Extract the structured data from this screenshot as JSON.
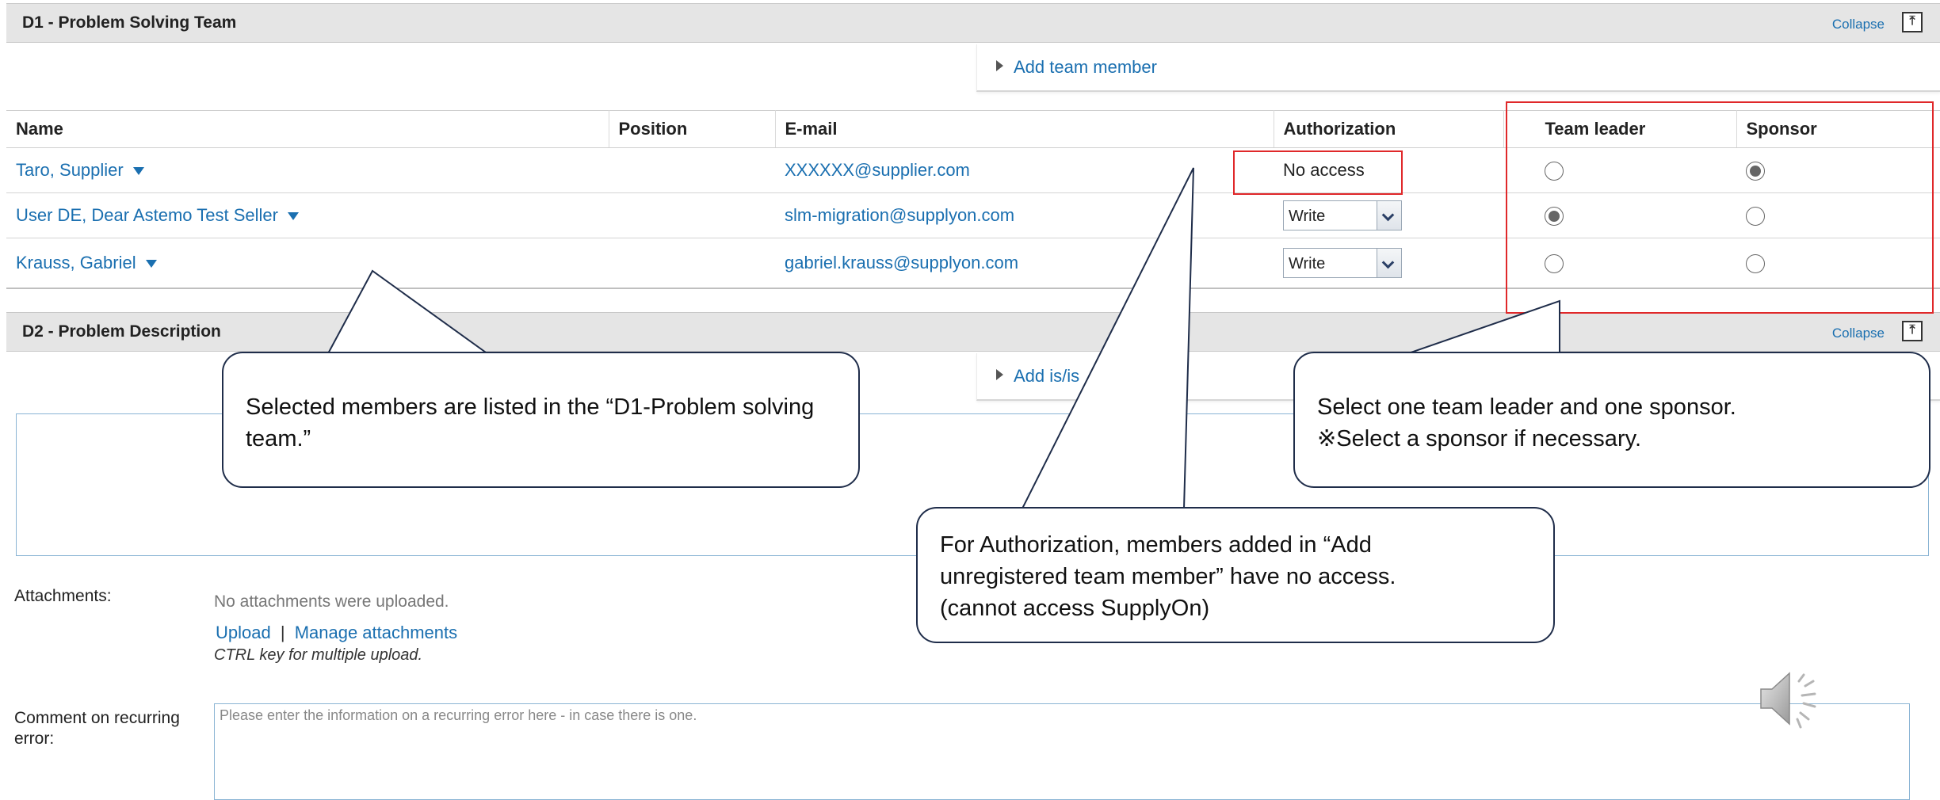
{
  "d1": {
    "title": "D1 - Problem Solving Team",
    "collapse": "Collapse",
    "add_link": "Add team member",
    "columns": [
      "Name",
      "Position",
      "E-mail",
      "Authorization",
      "Team leader",
      "Sponsor"
    ],
    "rows": [
      {
        "name": "Taro, Supplier",
        "position": "",
        "email": "XXXXXX@supplier.com",
        "authorization": "No access",
        "team_leader": false,
        "sponsor": true
      },
      {
        "name": "User DE, Dear Astemo Test Seller",
        "position": "",
        "email": "slm-migration@supplyon.com",
        "authorization": "Write",
        "team_leader": true,
        "sponsor": false
      },
      {
        "name": "Krauss, Gabriel",
        "position": "",
        "email": "gabriel.krauss@supplyon.com",
        "authorization": "Write",
        "team_leader": false,
        "sponsor": false
      }
    ]
  },
  "d2": {
    "title": "D2 - Problem Description",
    "collapse": "Collapse",
    "add_link": "Add is/is"
  },
  "attachments": {
    "label": "Attachments:",
    "none": "No attachments were uploaded.",
    "upload": "Upload",
    "separator": "|",
    "manage": "Manage attachments",
    "hint": "CTRL key for multiple upload."
  },
  "comment": {
    "label": "Comment on recurring error:",
    "placeholder": "Please enter the information on a recurring error here - in case there is one."
  },
  "callouts": {
    "members": "Selected members are listed in the “D1-Problem solving team.”",
    "leader_line1": "Select one team leader and one sponsor.",
    "leader_line2": "※Select a sponsor if necessary.",
    "auth_line1": "For Authorization, members added in “Add",
    "auth_line2": "unregistered team member” have no access.",
    "auth_line3": "(cannot access SupplyOn)"
  },
  "colors": {
    "link": "#1a6fb0",
    "highlight": "#e0282a",
    "header_bg": "#e5e5e5"
  },
  "icons": [
    "collapse-icon",
    "expand-triangle-icon",
    "dropdown-caret-icon",
    "speaker-icon"
  ]
}
